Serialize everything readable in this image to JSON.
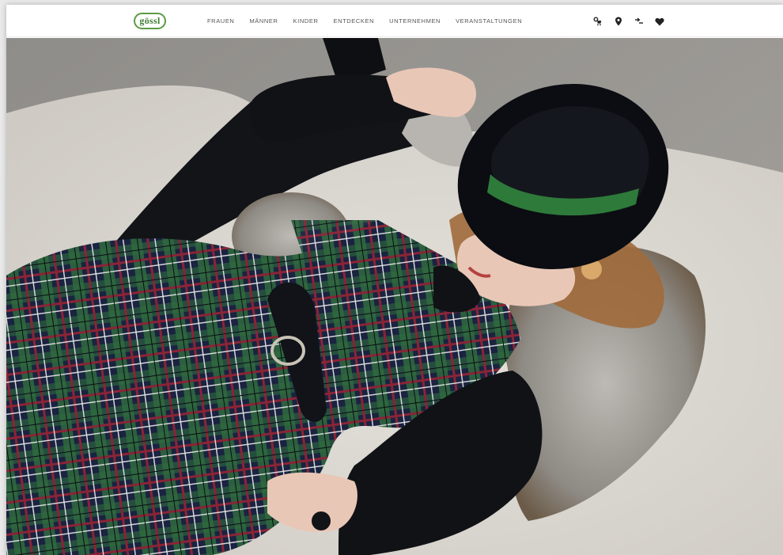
{
  "brand": {
    "logo_text": "gössl",
    "accent": "#5c9a43"
  },
  "nav": {
    "items": [
      {
        "label": "FRAUEN"
      },
      {
        "label": "MÄNNER"
      },
      {
        "label": "KINDER"
      },
      {
        "label": "ENTDECKEN"
      },
      {
        "label": "UNTERNEHMEN"
      },
      {
        "label": "VERANSTALTUNGEN"
      }
    ]
  },
  "header_icons": [
    {
      "name": "cart-icon"
    },
    {
      "name": "location-pin-icon"
    },
    {
      "name": "language-switch-icon"
    },
    {
      "name": "heart-icon"
    }
  ],
  "hero": {
    "colors": {
      "background": "#9c9a96",
      "fur_rug": "#d9d6d0",
      "black": "#101216",
      "tartan_green": "#2f6a3e",
      "tartan_navy": "#1a2340",
      "tartan_red": "#8a2436",
      "hat_band": "#2e7a3a",
      "skin": "#e9c7b6",
      "hair": "#a06a3b"
    }
  }
}
